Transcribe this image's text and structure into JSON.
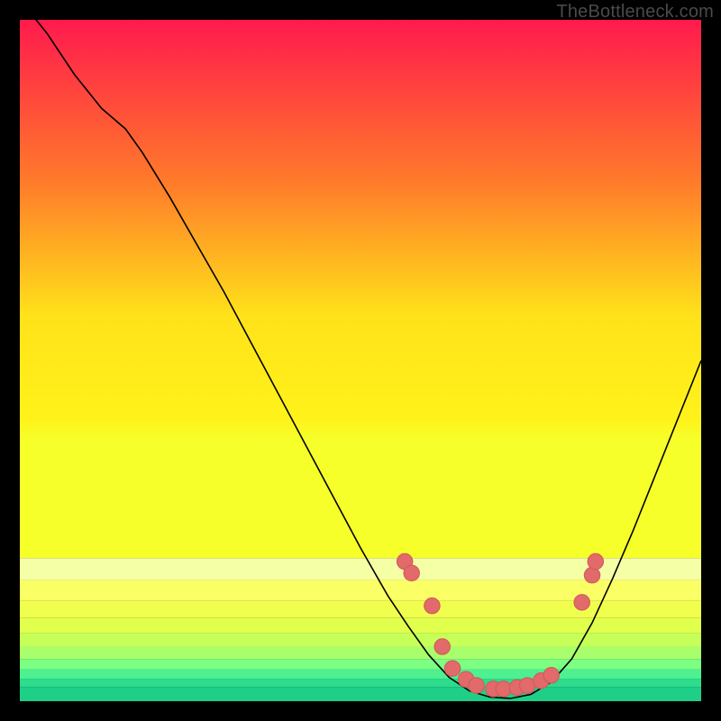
{
  "watermark": "TheBottleneck.com",
  "colors": {
    "gradient_top": "#ff1a4d",
    "gradient_mid1": "#ff8a1a",
    "gradient_mid2": "#ffe21a",
    "gradient_mid3": "#f3ff1a",
    "gradient_bottom_yellow": "#e8ff33",
    "gradient_stripe1": "#d6ff59",
    "gradient_stripe2": "#9dff85",
    "gradient_stripe3": "#4be88f",
    "gradient_stripe4": "#25d88c",
    "gradient_stripe5": "#19cf86",
    "curve": "#000000",
    "marker_fill": "#e26a6a",
    "marker_stroke": "#d45a5a",
    "frame": "#000000"
  },
  "chart_data": {
    "type": "line",
    "title": "",
    "xlabel": "",
    "ylabel": "",
    "xlim": [
      0,
      100
    ],
    "ylim": [
      0,
      100
    ],
    "curve": [
      {
        "x": 0,
        "y": 103
      },
      {
        "x": 4,
        "y": 98
      },
      {
        "x": 8,
        "y": 92
      },
      {
        "x": 12,
        "y": 87
      },
      {
        "x": 15.5,
        "y": 84
      },
      {
        "x": 18,
        "y": 80.5
      },
      {
        "x": 22,
        "y": 74
      },
      {
        "x": 26,
        "y": 67
      },
      {
        "x": 30,
        "y": 60
      },
      {
        "x": 34,
        "y": 52.5
      },
      {
        "x": 38,
        "y": 45
      },
      {
        "x": 42,
        "y": 37.5
      },
      {
        "x": 46,
        "y": 30
      },
      {
        "x": 50,
        "y": 22.5
      },
      {
        "x": 54,
        "y": 15.5
      },
      {
        "x": 57,
        "y": 11
      },
      {
        "x": 60,
        "y": 6.8
      },
      {
        "x": 63,
        "y": 3.5
      },
      {
        "x": 66,
        "y": 1.5
      },
      {
        "x": 69,
        "y": 0.6
      },
      {
        "x": 72,
        "y": 0.4
      },
      {
        "x": 75,
        "y": 1.0
      },
      {
        "x": 78,
        "y": 2.8
      },
      {
        "x": 81,
        "y": 6.2
      },
      {
        "x": 84,
        "y": 11.5
      },
      {
        "x": 87,
        "y": 18
      },
      {
        "x": 90,
        "y": 25
      },
      {
        "x": 93,
        "y": 32.5
      },
      {
        "x": 96,
        "y": 40
      },
      {
        "x": 100,
        "y": 50
      }
    ],
    "markers": [
      {
        "x": 56.5,
        "y": 20.5
      },
      {
        "x": 57.5,
        "y": 18.8
      },
      {
        "x": 60.5,
        "y": 14.0
      },
      {
        "x": 62.0,
        "y": 8.0
      },
      {
        "x": 63.5,
        "y": 4.8
      },
      {
        "x": 65.5,
        "y": 3.2
      },
      {
        "x": 67.0,
        "y": 2.3
      },
      {
        "x": 69.5,
        "y": 1.8
      },
      {
        "x": 71.0,
        "y": 1.8
      },
      {
        "x": 73.0,
        "y": 2.0
      },
      {
        "x": 74.5,
        "y": 2.3
      },
      {
        "x": 76.5,
        "y": 3.0
      },
      {
        "x": 78.0,
        "y": 3.8
      },
      {
        "x": 82.5,
        "y": 14.5
      },
      {
        "x": 84.0,
        "y": 18.5
      },
      {
        "x": 84.5,
        "y": 20.5
      }
    ]
  }
}
